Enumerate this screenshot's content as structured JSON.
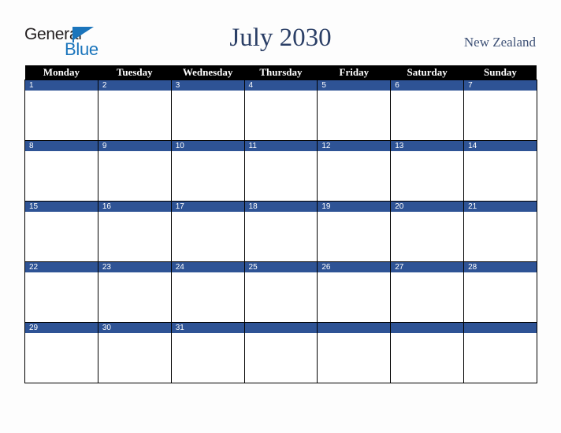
{
  "brand": {
    "name_part1": "General",
    "name_part2": "Blue",
    "triangle_color": "#1b75bc",
    "text_color": "#231f20"
  },
  "header": {
    "title": "July 2030",
    "country": "New Zealand",
    "title_color": "#2b3f66",
    "country_color": "#3f5277"
  },
  "calendar": {
    "month": "July",
    "year": "2030",
    "accent_color": "#2e5395",
    "header_bg": "#000000",
    "header_fg": "#ffffff",
    "weekday_headers": [
      "Monday",
      "Tuesday",
      "Wednesday",
      "Thursday",
      "Friday",
      "Saturday",
      "Sunday"
    ],
    "weeks": [
      [
        {
          "day": "1",
          "events": ""
        },
        {
          "day": "2",
          "events": ""
        },
        {
          "day": "3",
          "events": ""
        },
        {
          "day": "4",
          "events": ""
        },
        {
          "day": "5",
          "events": ""
        },
        {
          "day": "6",
          "events": ""
        },
        {
          "day": "7",
          "events": ""
        }
      ],
      [
        {
          "day": "8",
          "events": ""
        },
        {
          "day": "9",
          "events": ""
        },
        {
          "day": "10",
          "events": ""
        },
        {
          "day": "11",
          "events": ""
        },
        {
          "day": "12",
          "events": ""
        },
        {
          "day": "13",
          "events": ""
        },
        {
          "day": "14",
          "events": ""
        }
      ],
      [
        {
          "day": "15",
          "events": ""
        },
        {
          "day": "16",
          "events": ""
        },
        {
          "day": "17",
          "events": ""
        },
        {
          "day": "18",
          "events": ""
        },
        {
          "day": "19",
          "events": ""
        },
        {
          "day": "20",
          "events": ""
        },
        {
          "day": "21",
          "events": ""
        }
      ],
      [
        {
          "day": "22",
          "events": ""
        },
        {
          "day": "23",
          "events": ""
        },
        {
          "day": "24",
          "events": ""
        },
        {
          "day": "25",
          "events": ""
        },
        {
          "day": "26",
          "events": ""
        },
        {
          "day": "27",
          "events": ""
        },
        {
          "day": "28",
          "events": ""
        }
      ],
      [
        {
          "day": "29",
          "events": ""
        },
        {
          "day": "30",
          "events": ""
        },
        {
          "day": "31",
          "events": ""
        },
        {
          "day": "",
          "events": ""
        },
        {
          "day": "",
          "events": ""
        },
        {
          "day": "",
          "events": ""
        },
        {
          "day": "",
          "events": ""
        }
      ]
    ]
  }
}
